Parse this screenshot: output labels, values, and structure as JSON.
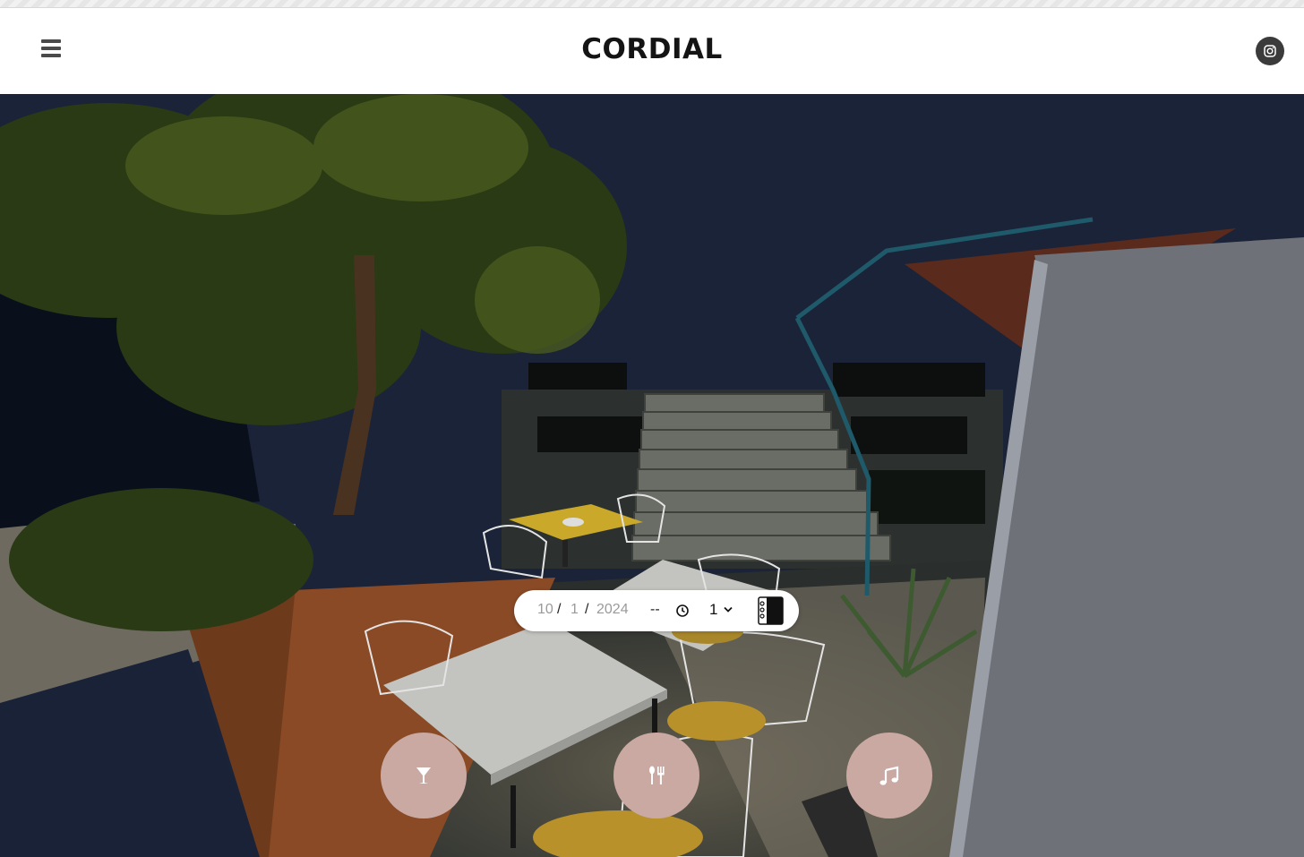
{
  "header": {
    "brand": "CORDIAL",
    "menu_icon": "hamburger-menu-icon",
    "social_icon": "instagram-icon"
  },
  "booking": {
    "month": "10",
    "day": "1",
    "year": "2024",
    "date_separator": "/",
    "time": "--",
    "party_size": "1",
    "icons": [
      "clock-icon",
      "chevron-down-icon",
      "reservation-book-icon"
    ]
  },
  "actions": [
    {
      "name": "drinks",
      "icon": "cocktail-glass-icon"
    },
    {
      "name": "food",
      "icon": "fork-knife-icon"
    },
    {
      "name": "music",
      "icon": "music-note-icon"
    }
  ],
  "colors": {
    "action_button_bg": "#c9a9a2",
    "night_sky": "#1b2338",
    "header_bg": "#ffffff",
    "wood_deck": "#8a4a26",
    "table_yellow": "#c9a82a"
  }
}
